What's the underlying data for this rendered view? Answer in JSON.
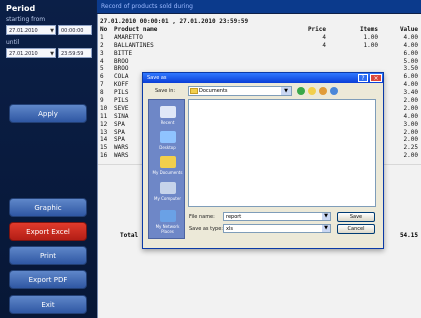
{
  "sidebar": {
    "period_label": "Period",
    "starting_from_label": "starting from",
    "until_label": "until",
    "from_date": "27.01.2010",
    "from_time": "00:00:00",
    "until_date": "27.01.2010",
    "until_time": "23:59:59",
    "buttons": {
      "apply": "Apply",
      "graphic": "Graphic",
      "export_excel": "Export Excel",
      "print": "Print",
      "export_pdf": "Export PDF",
      "exit": "Exit"
    },
    "colors": {
      "primary_button": "#3c66b1",
      "danger_button": "#c92a1d"
    }
  },
  "report": {
    "header": "Record of products sold during",
    "range": "27.01.2010 00:00:01 , 27.01.2010 23:59:59",
    "columns": {
      "no": "No",
      "product": "Product name",
      "price": "Price",
      "items": "Items",
      "value": "Value"
    },
    "rows": [
      {
        "no": "1",
        "name": "AMARETTO",
        "price": "4",
        "items": "1.00",
        "value": "4.00"
      },
      {
        "no": "2",
        "name": "BALLANTINES",
        "price": "4",
        "items": "1.00",
        "value": "4.00"
      },
      {
        "no": "3",
        "name": "BITTE",
        "price": "",
        "items": "",
        "value": "6.00"
      },
      {
        "no": "4",
        "name": "BROO",
        "price": "",
        "items": "",
        "value": "5.00"
      },
      {
        "no": "5",
        "name": "BROO",
        "price": "",
        "items": "",
        "value": "3.50"
      },
      {
        "no": "6",
        "name": "COLA",
        "price": "",
        "items": "",
        "value": "6.00"
      },
      {
        "no": "7",
        "name": "KOFF",
        "price": "",
        "items": "",
        "value": "4.00"
      },
      {
        "no": "8",
        "name": "PILS",
        "price": "",
        "items": "",
        "value": "3.40"
      },
      {
        "no": "9",
        "name": "PILS",
        "price": "",
        "items": "",
        "value": "2.00"
      },
      {
        "no": "10",
        "name": "SEVE",
        "price": "",
        "items": "",
        "value": "2.00"
      },
      {
        "no": "11",
        "name": "SINA",
        "price": "",
        "items": "",
        "value": "4.00"
      },
      {
        "no": "12",
        "name": "SPA",
        "price": "",
        "items": "",
        "value": "3.00"
      },
      {
        "no": "13",
        "name": "SPA",
        "price": "",
        "items": "",
        "value": "2.00"
      },
      {
        "no": "14",
        "name": "SPA",
        "price": "",
        "items": "",
        "value": "2.00"
      },
      {
        "no": "15",
        "name": "WARS",
        "price": "",
        "items": "",
        "value": "2.25"
      },
      {
        "no": "16",
        "name": "WARS",
        "price": "",
        "items": "",
        "value": "2.00"
      }
    ],
    "total_label": "Total",
    "total_value": "54.15"
  },
  "dialog": {
    "title": "Save as",
    "save_in_label": "Save in:",
    "save_in_value": "Documents",
    "places": [
      "Recent",
      "Desktop",
      "My Documents",
      "My Computer",
      "My Network Places"
    ],
    "file_name_label": "File name:",
    "file_name_value": "report",
    "file_type_label": "Save as type:",
    "file_type_value": "xls",
    "save_button": "Save",
    "cancel_button": "Cancel",
    "colors": {
      "titlebar": "#0a3ed7",
      "places_bar": "#6e87c7",
      "body": "#ece9d8"
    }
  }
}
